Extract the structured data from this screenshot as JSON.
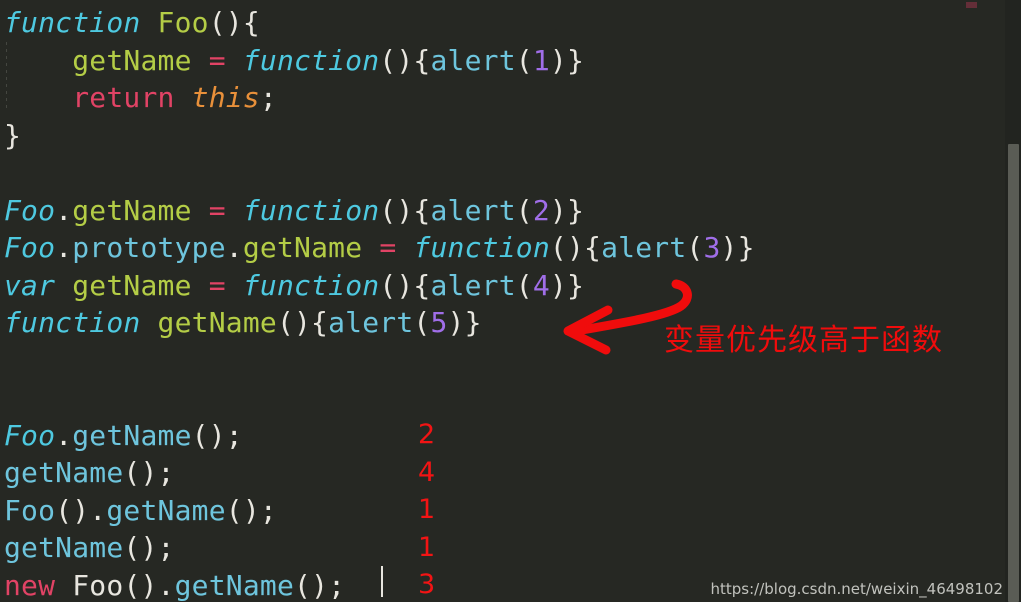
{
  "editor": {
    "background_color": "#262823",
    "code_lines": [
      {
        "id": "line-1",
        "tokens": [
          {
            "text": "function ",
            "style": "kw"
          },
          {
            "text": "Foo",
            "style": "func"
          },
          {
            "text": "(){",
            "style": "punc"
          }
        ]
      },
      {
        "id": "line-2",
        "tokens": [
          {
            "text": "    ",
            "style": "plain"
          },
          {
            "text": "getName",
            "style": "func"
          },
          {
            "text": " ",
            "style": "plain"
          },
          {
            "text": "=",
            "style": "op"
          },
          {
            "text": " ",
            "style": "plain"
          },
          {
            "text": "function",
            "style": "kw"
          },
          {
            "text": "(){",
            "style": "punc"
          },
          {
            "text": "alert",
            "style": "call"
          },
          {
            "text": "(",
            "style": "punc"
          },
          {
            "text": "1",
            "style": "num"
          },
          {
            "text": ")}",
            "style": "punc"
          }
        ]
      },
      {
        "id": "line-3",
        "tokens": [
          {
            "text": "    ",
            "style": "plain"
          },
          {
            "text": "return",
            "style": "kw2"
          },
          {
            "text": " ",
            "style": "plain"
          },
          {
            "text": "this",
            "style": "this"
          },
          {
            "text": ";",
            "style": "punc"
          }
        ]
      },
      {
        "id": "line-4",
        "tokens": [
          {
            "text": "}",
            "style": "punc"
          }
        ]
      },
      {
        "id": "line-5",
        "blank": true,
        "tokens": []
      },
      {
        "id": "line-6",
        "tokens": [
          {
            "text": "Foo",
            "style": "kw"
          },
          {
            "text": ".",
            "style": "punc"
          },
          {
            "text": "getName",
            "style": "func"
          },
          {
            "text": " ",
            "style": "plain"
          },
          {
            "text": "=",
            "style": "op"
          },
          {
            "text": " ",
            "style": "plain"
          },
          {
            "text": "function",
            "style": "kw"
          },
          {
            "text": "(){",
            "style": "punc"
          },
          {
            "text": "alert",
            "style": "call"
          },
          {
            "text": "(",
            "style": "punc"
          },
          {
            "text": "2",
            "style": "num"
          },
          {
            "text": ")}",
            "style": "punc"
          }
        ]
      },
      {
        "id": "line-7",
        "tokens": [
          {
            "text": "Foo",
            "style": "kw"
          },
          {
            "text": ".",
            "style": "punc"
          },
          {
            "text": "prototype",
            "style": "cyan"
          },
          {
            "text": ".",
            "style": "punc"
          },
          {
            "text": "getName",
            "style": "func"
          },
          {
            "text": " ",
            "style": "plain"
          },
          {
            "text": "=",
            "style": "op"
          },
          {
            "text": " ",
            "style": "plain"
          },
          {
            "text": "function",
            "style": "kw"
          },
          {
            "text": "(){",
            "style": "punc"
          },
          {
            "text": "alert",
            "style": "call"
          },
          {
            "text": "(",
            "style": "punc"
          },
          {
            "text": "3",
            "style": "num"
          },
          {
            "text": ")}",
            "style": "punc"
          }
        ]
      },
      {
        "id": "line-8",
        "tokens": [
          {
            "text": "var",
            "style": "kw"
          },
          {
            "text": " ",
            "style": "plain"
          },
          {
            "text": "getName",
            "style": "func"
          },
          {
            "text": " ",
            "style": "plain"
          },
          {
            "text": "=",
            "style": "op"
          },
          {
            "text": " ",
            "style": "plain"
          },
          {
            "text": "function",
            "style": "kw"
          },
          {
            "text": "(){",
            "style": "punc"
          },
          {
            "text": "alert",
            "style": "call"
          },
          {
            "text": "(",
            "style": "punc"
          },
          {
            "text": "4",
            "style": "num"
          },
          {
            "text": ")}",
            "style": "punc"
          }
        ]
      },
      {
        "id": "line-9",
        "tokens": [
          {
            "text": "function",
            "style": "kw"
          },
          {
            "text": " ",
            "style": "plain"
          },
          {
            "text": "getName",
            "style": "func"
          },
          {
            "text": "(){",
            "style": "punc"
          },
          {
            "text": "alert",
            "style": "call"
          },
          {
            "text": "(",
            "style": "punc"
          },
          {
            "text": "5",
            "style": "num"
          },
          {
            "text": ")}",
            "style": "punc"
          }
        ]
      },
      {
        "id": "line-10",
        "blank": true,
        "tokens": []
      },
      {
        "id": "line-11",
        "blank": true,
        "tokens": []
      },
      {
        "id": "line-12",
        "tokens": [
          {
            "text": "Foo",
            "style": "kw"
          },
          {
            "text": ".",
            "style": "punc"
          },
          {
            "text": "getName",
            "style": "call"
          },
          {
            "text": "();",
            "style": "punc"
          }
        ]
      },
      {
        "id": "line-13",
        "tokens": [
          {
            "text": "getName",
            "style": "call"
          },
          {
            "text": "();",
            "style": "punc"
          }
        ]
      },
      {
        "id": "line-14",
        "tokens": [
          {
            "text": "Foo",
            "style": "cyan"
          },
          {
            "text": "().",
            "style": "punc"
          },
          {
            "text": "getName",
            "style": "call"
          },
          {
            "text": "();",
            "style": "punc"
          }
        ]
      },
      {
        "id": "line-15",
        "tokens": [
          {
            "text": "getName",
            "style": "call"
          },
          {
            "text": "();",
            "style": "punc"
          }
        ]
      },
      {
        "id": "line-16",
        "tokens": [
          {
            "text": "new",
            "style": "kw2"
          },
          {
            "text": " ",
            "style": "plain"
          },
          {
            "text": "Foo",
            "style": "plain"
          },
          {
            "text": "().",
            "style": "punc"
          },
          {
            "text": "getName",
            "style": "call"
          },
          {
            "text": "();",
            "style": "punc"
          }
        ]
      }
    ],
    "plain_code": "function Foo(){\n    getName = function(){alert(1)}\n    return this;\n}\n\nFoo.getName = function(){alert(2)}\nFoo.prototype.getName = function(){alert(3)}\nvar getName = function(){alert(4)}\nfunction getName(){alert(5)}\n\n\nFoo.getName();\ngetName();\nFoo().getName();\ngetName();\nnew Foo().getName();"
  },
  "results": {
    "color": "#f21414",
    "values": [
      "2",
      "4",
      "1",
      "1",
      "3"
    ]
  },
  "annotation": {
    "text": "变量优先级高于函数",
    "color": "#f00c0c",
    "arrow_name": "curved-left-arrow"
  },
  "watermark": {
    "text": "https://blog.csdn.net/weixin_46498102"
  },
  "scrollbar": {
    "thumb_color": "#5a5c55",
    "track_color": "#222420"
  }
}
